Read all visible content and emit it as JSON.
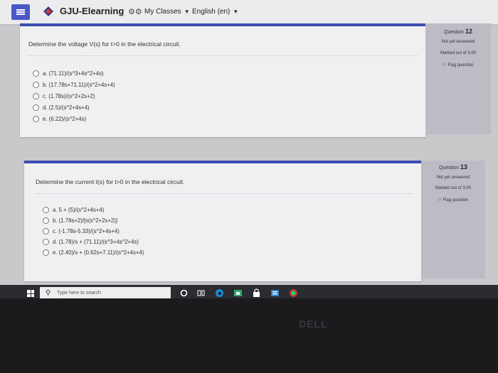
{
  "header": {
    "brand": "GJU-Elearning",
    "classes_label": "My Classes",
    "language_label": "English (en)"
  },
  "questions": [
    {
      "number_label": "Question",
      "number": "12",
      "status": "Not yet answered",
      "marks": "Marked out of 3.00",
      "flag": "Flag question",
      "text": "Determine the voltage V(s) for t>0 in the electrical circuit.",
      "options": [
        "a. (71.11)/(s^3+4s^2+4s)",
        "b. (17.78s+71.11)/(s^2+4s+4)",
        "c. (1.78s)/(s^2+2s+2)",
        "d. (2.5)/(s^2+4s+4)",
        "e. (6.22)/(s^2+4s)"
      ]
    },
    {
      "number_label": "Question",
      "number": "13",
      "status": "Not yet answered",
      "marks": "Marked out of 3.00",
      "flag": "Flag question",
      "text": "Determine the current I(s) for t>0 in the electrical circuit.",
      "options": [
        "a. 5 + (5)/(s^2+4s+4)",
        "b. (1.78s+2)/[s(s^2+2s+2)]",
        "c. (-1.78s-5.33)/(s^2+4s+4)",
        "d. (1.78)/s + (71.11)/(s^3+4s^2+4s)",
        "e. (2.40)/s + (0.62s+7.11)/(s^2+4s+4)"
      ]
    }
  ],
  "taskbar": {
    "search_placeholder": "Type here to search",
    "icons": [
      "cortana-icon",
      "task-view-icon",
      "edge-icon",
      "store-icon",
      "lock-icon",
      "files-icon",
      "photos-icon"
    ]
  },
  "bezel": {
    "brand": "DELL"
  },
  "colors": {
    "accent": "#3c4db0",
    "taskbar": "#2a2c31"
  }
}
